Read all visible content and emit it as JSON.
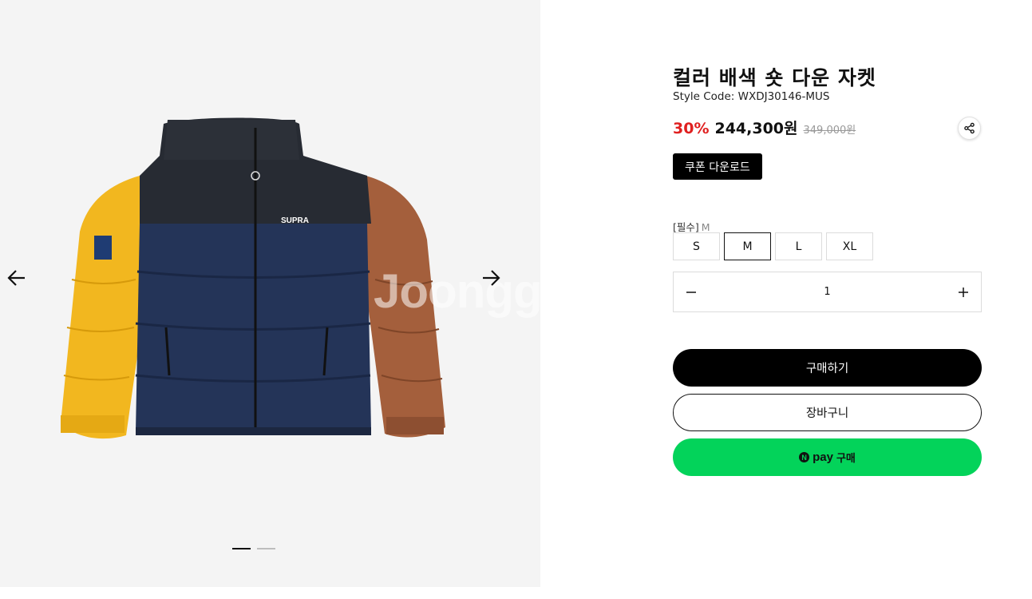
{
  "gallery": {
    "watermark": "Joongg",
    "jacket_logo": "SUPRA",
    "slides_total": 2,
    "slide_active": 1,
    "prev_icon": "arrow-left-icon",
    "next_icon": "arrow-right-icon"
  },
  "product": {
    "title": "컬러 배색 숏 다운 자켓",
    "style_code": "Style Code: WXDJ30146-MUS",
    "discount": "30%",
    "sale_price": "244,300원",
    "original_price": "349,000원",
    "share_icon": "share-icon",
    "coupon_label": "쿠폰 다운로드"
  },
  "options": {
    "size_label": "[필수]",
    "selected_size": "M",
    "sizes": [
      "S",
      "M",
      "L",
      "XL"
    ]
  },
  "quantity": {
    "value": "1",
    "minus_icon": "minus-icon",
    "plus_icon": "plus-icon"
  },
  "actions": {
    "buy_label": "구매하기",
    "cart_label": "장바구니",
    "npay_logo": "N",
    "npay_word": "pay",
    "npay_buy": "구매"
  },
  "colors": {
    "discount": "#e02020",
    "npay_green": "#03d35a",
    "primary": "#000000",
    "gallery_bg": "#f4f4f4"
  }
}
